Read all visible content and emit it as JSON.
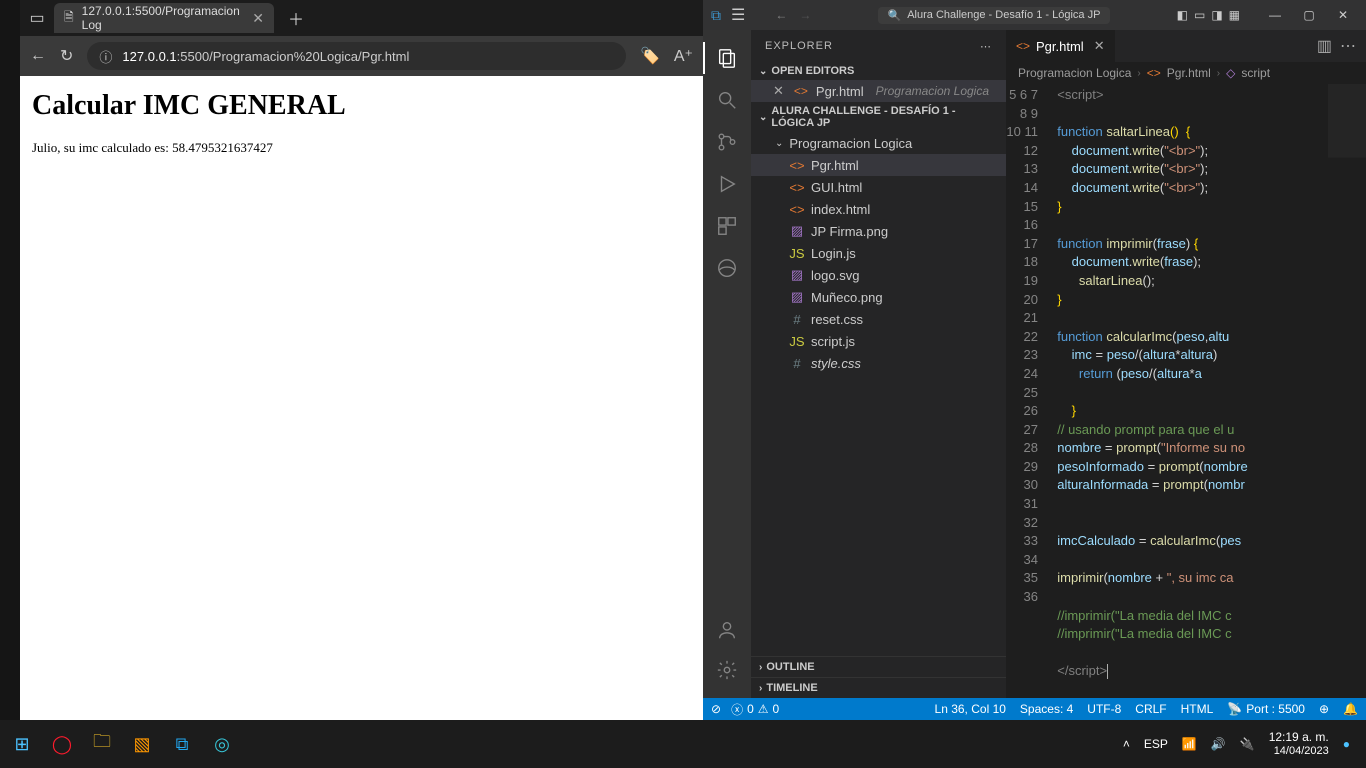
{
  "browser": {
    "tab_title": "127.0.0.1:5500/Programacion Log",
    "url_host": "127.0.0.1",
    "url_port_path": ":5500/Programacion%20Logica/Pgr.html",
    "page_heading": "Calcular IMC GENERAL",
    "page_text": "Julio, su imc calculado es: 58.4795321637427"
  },
  "vscode": {
    "search_placeholder": "Alura Challenge - Desafío 1 - Lógica JP",
    "explorer_label": "EXPLORER",
    "open_editors_label": "OPEN EDITORS",
    "open_editor_file": "Pgr.html",
    "open_editor_folder": "Programacion Logica",
    "workspace_label": "ALURA CHALLENGE - DESAFÍO 1 - LÓGICA JP",
    "root_folder": "Programacion Logica",
    "files": [
      {
        "name": "Pgr.html",
        "icon": "html",
        "selected": true
      },
      {
        "name": "GUI.html",
        "icon": "html"
      },
      {
        "name": "index.html",
        "icon": "html"
      },
      {
        "name": "JP Firma.png",
        "icon": "img"
      },
      {
        "name": "Login.js",
        "icon": "js"
      },
      {
        "name": "logo.svg",
        "icon": "svg"
      },
      {
        "name": "Muñeco.png",
        "icon": "img"
      },
      {
        "name": "reset.css",
        "icon": "css"
      },
      {
        "name": "script.js",
        "icon": "js"
      },
      {
        "name": "style.css",
        "icon": "cssitalic"
      }
    ],
    "outline_label": "OUTLINE",
    "timeline_label": "TIMELINE",
    "tab_file": "Pgr.html",
    "crumbs": {
      "folder": "Programacion Logica",
      "file": "Pgr.html",
      "symbol": "script"
    },
    "code_lines": [
      {
        "n": 5,
        "html": "  <span class='tok-tag'>&lt;script&gt;</span>"
      },
      {
        "n": 6,
        "html": ""
      },
      {
        "n": 7,
        "html": "  <span class='tok-kw'>function</span> <span class='tok-fn'>saltarLinea</span><span class='tok-br'>()</span>  <span class='tok-br'>{</span>"
      },
      {
        "n": 8,
        "html": "      <span class='tok-var'>document</span>.<span class='tok-fn'>write</span>(<span class='tok-str'>\"&lt;br&gt;\"</span>);"
      },
      {
        "n": 9,
        "html": "      <span class='tok-var'>document</span>.<span class='tok-fn'>write</span>(<span class='tok-str'>\"&lt;br&gt;\"</span>);"
      },
      {
        "n": 10,
        "html": "      <span class='tok-var'>document</span>.<span class='tok-fn'>write</span>(<span class='tok-str'>\"&lt;br&gt;\"</span>);"
      },
      {
        "n": 11,
        "html": "  <span class='tok-br'>}</span>"
      },
      {
        "n": 12,
        "html": ""
      },
      {
        "n": 13,
        "html": "  <span class='tok-kw'>function</span> <span class='tok-fn'>imprimir</span>(<span class='tok-var'>frase</span>) <span class='tok-br'>{</span>"
      },
      {
        "n": 14,
        "html": "      <span class='tok-var'>document</span>.<span class='tok-fn'>write</span>(<span class='tok-var'>frase</span>);"
      },
      {
        "n": 15,
        "html": "        <span class='tok-fn'>saltarLinea</span>();"
      },
      {
        "n": 16,
        "html": "  <span class='tok-br'>}</span>"
      },
      {
        "n": 17,
        "html": ""
      },
      {
        "n": 18,
        "html": "  <span class='tok-kw'>function</span> <span class='tok-fn'>calcularImc</span>(<span class='tok-var'>peso</span>,<span class='tok-var'>altu</span>"
      },
      {
        "n": 19,
        "html": "      <span class='tok-var'>imc</span> = <span class='tok-var'>peso</span>/(<span class='tok-var'>altura</span>*<span class='tok-var'>altura</span>)"
      },
      {
        "n": 20,
        "html": "        <span class='tok-kw'>return</span> (<span class='tok-var'>peso</span>/(<span class='tok-var'>altura</span>*<span class='tok-var'>a</span>"
      },
      {
        "n": 21,
        "html": ""
      },
      {
        "n": 22,
        "html": "      <span class='tok-br'>}</span>"
      },
      {
        "n": 23,
        "html": "  <span class='tok-cm'>// usando prompt para que el u</span>"
      },
      {
        "n": 24,
        "html": "  <span class='tok-var'>nombre</span> = <span class='tok-fn'>prompt</span>(<span class='tok-str'>\"Informe su no</span>"
      },
      {
        "n": 25,
        "html": "  <span class='tok-var'>pesoInformado</span> = <span class='tok-fn'>prompt</span>(<span class='tok-var'>nombre</span> "
      },
      {
        "n": 26,
        "html": "  <span class='tok-var'>alturaInformada</span> = <span class='tok-fn'>prompt</span>(<span class='tok-var'>nombr</span>"
      },
      {
        "n": 27,
        "html": ""
      },
      {
        "n": 28,
        "html": ""
      },
      {
        "n": 29,
        "html": "  <span class='tok-var'>imcCalculado</span> = <span class='tok-fn'>calcularImc</span>(<span class='tok-var'>pes</span>"
      },
      {
        "n": 30,
        "html": ""
      },
      {
        "n": 31,
        "html": "  <span class='tok-fn'>imprimir</span>(<span class='tok-var'>nombre</span> + <span class='tok-str'>\", su imc ca</span>"
      },
      {
        "n": 32,
        "html": ""
      },
      {
        "n": 33,
        "html": "  <span class='tok-cm'>//imprimir(\"La media del IMC c</span>"
      },
      {
        "n": 34,
        "html": "  <span class='tok-cm'>//imprimir(\"La media del IMC c</span>"
      },
      {
        "n": 35,
        "html": ""
      },
      {
        "n": 36,
        "html": "  <span class='tok-tag'>&lt;/script&gt;</span><span class='caret'></span>"
      }
    ],
    "status": {
      "errors": "0",
      "warnings": "0",
      "cursor": "Ln 36, Col 10",
      "spaces": "Spaces: 4",
      "encoding": "UTF-8",
      "eol": "CRLF",
      "lang": "HTML",
      "port": "Port : 5500"
    }
  },
  "taskbar": {
    "lang": "ESP",
    "time": "12:19 a. m.",
    "date": "14/04/2023"
  }
}
